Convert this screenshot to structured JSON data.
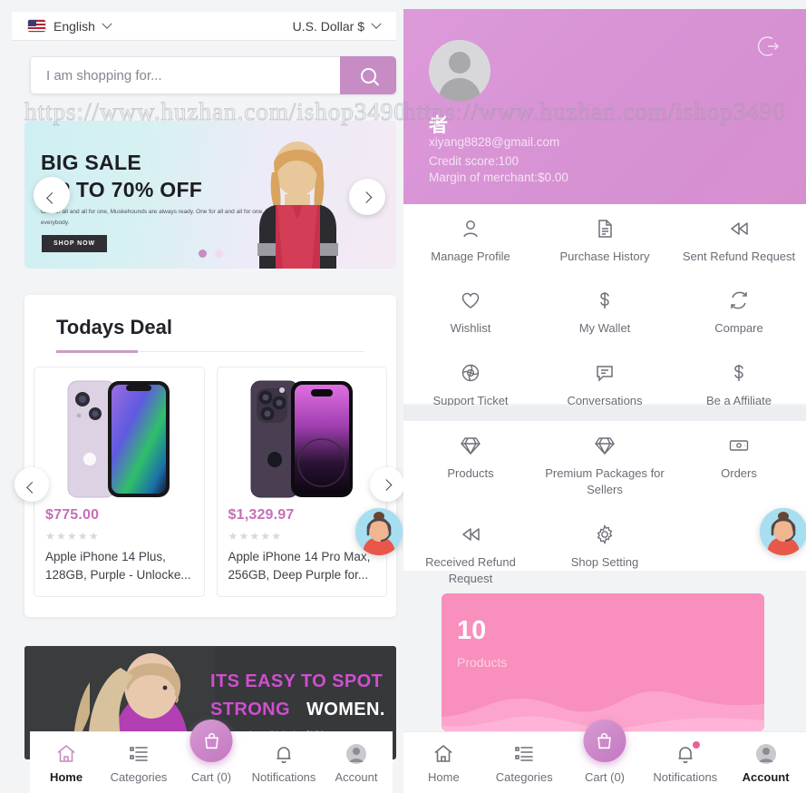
{
  "left": {
    "topbar": {
      "language": "English",
      "currency": "U.S. Dollar $",
      "flag_icon": "us-flag-icon"
    },
    "search": {
      "placeholder": "I am shopping for...",
      "value": "",
      "icon": "search-icon"
    },
    "watermark": "https://www.huzhan.com/ishop3490",
    "hero": {
      "title": "BIG SALE",
      "subtitle": "UP TO 70% OFF",
      "description": "One for all and all for one, Muskehounds are always ready. One for all and all for one, help for everybody.",
      "cta": "SHOP NOW",
      "prev_label": "‹",
      "next_label": "›",
      "dots": 2,
      "active_dot": 0
    },
    "deals": {
      "section_title": "Todays Deal",
      "prev_label": "‹",
      "next_label": "›",
      "products": [
        {
          "price": "$775.00",
          "rating": "★★★★★",
          "name": "Apple iPhone 14 Plus, 128GB, Purple - Unlocke..."
        },
        {
          "price": "$1,329.97",
          "rating": "★★★★★",
          "name": "Apple iPhone 14 Pro Max, 256GB, Deep Purple for..."
        }
      ]
    },
    "promo": {
      "line1": "ITS EASY TO SPOT",
      "line2_accent": "STRONG",
      "line2_plain": "WOMEN.",
      "subtext": "the ones who nail it in the GYM"
    },
    "bottom_nav": {
      "items": [
        {
          "label": "Home",
          "icon": "home-icon",
          "active": true
        },
        {
          "label": "Categories",
          "icon": "list-icon",
          "active": false
        },
        {
          "label": "Cart (0)",
          "icon": "shopping-bag-icon",
          "active": false
        },
        {
          "label": "Notifications",
          "icon": "bell-icon",
          "active": false,
          "badge": false
        },
        {
          "label": "Account",
          "icon": "account-avatar-icon",
          "active": false
        }
      ]
    },
    "support_widget": "support-agent-icon"
  },
  "right": {
    "profile": {
      "name": "者",
      "email": "xiyang8828@gmail.com",
      "credit": "Credit score:100",
      "margin": "Margin of merchant:$0.00",
      "logout_icon": "logout-icon",
      "avatar_icon": "default-avatar-icon"
    },
    "user_menu": [
      {
        "label": "Manage Profile",
        "icon": "user-icon"
      },
      {
        "label": "Purchase History",
        "icon": "document-icon"
      },
      {
        "label": "Sent Refund Request",
        "icon": "rewind-icon"
      },
      {
        "label": "Wishlist",
        "icon": "heart-icon"
      },
      {
        "label": "My Wallet",
        "icon": "dollar-icon"
      },
      {
        "label": "Compare",
        "icon": "refresh-icon"
      },
      {
        "label": "Support Ticket",
        "icon": "lifebuoy-icon"
      },
      {
        "label": "Conversations",
        "icon": "chat-icon"
      },
      {
        "label": "Be a Affiliate",
        "icon": "dollar-icon"
      }
    ],
    "seller_menu": [
      {
        "label": "Products",
        "icon": "diamond-icon"
      },
      {
        "label": "Premium Packages for Sellers",
        "icon": "diamond-icon"
      },
      {
        "label": "Orders",
        "icon": "banknote-icon"
      },
      {
        "label": "Received Refund Request",
        "icon": "rewind-icon"
      },
      {
        "label": "Shop Setting",
        "icon": "gear-icon"
      }
    ],
    "stat_card": {
      "number": "10",
      "label": "Products",
      "color": "#f88fbd"
    },
    "bottom_nav": {
      "items": [
        {
          "label": "Home",
          "icon": "home-icon",
          "active": false
        },
        {
          "label": "Categories",
          "icon": "list-icon",
          "active": false
        },
        {
          "label": "Cart (0)",
          "icon": "shopping-bag-icon",
          "active": false
        },
        {
          "label": "Notifications",
          "icon": "bell-icon",
          "active": false,
          "badge": true
        },
        {
          "label": "Account",
          "icon": "account-avatar-icon",
          "active": true
        }
      ]
    },
    "support_widget": "support-agent-icon"
  },
  "theme": {
    "accent": "#c78cc4",
    "price": "#c76fb8",
    "pink": "#f88fbd",
    "profile_bg": "#d692d3"
  }
}
